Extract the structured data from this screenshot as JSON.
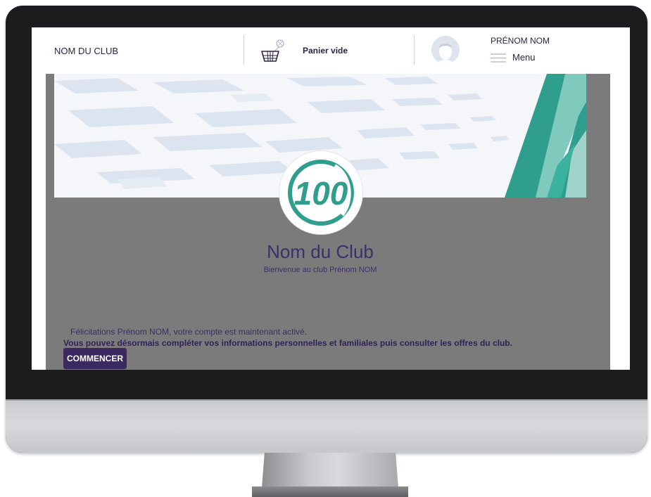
{
  "header": {
    "club_name": "NOM DU CLUB",
    "cart_label": "Panier vide",
    "user_name": "PRÉNOM NOM",
    "menu_label": "Menu"
  },
  "hero": {
    "logo_text": "100",
    "club_title": "Nom du Club",
    "welcome": "Bienvenue au club Prénom NOM"
  },
  "message": {
    "congrats": "Félicitations Prénom NOM, votre compte est maintenant activé.",
    "complete": "Vous pouvez désormais compléter vos informations personnelles et familiales puis consulter les offres du club.",
    "start_button": "COMMENCER"
  },
  "colors": {
    "brand_purple": "#3a2a5f",
    "title_purple": "#3c2f6a",
    "logo_teal": "#2f9e8c",
    "panel_grey": "#7b7b7b"
  }
}
